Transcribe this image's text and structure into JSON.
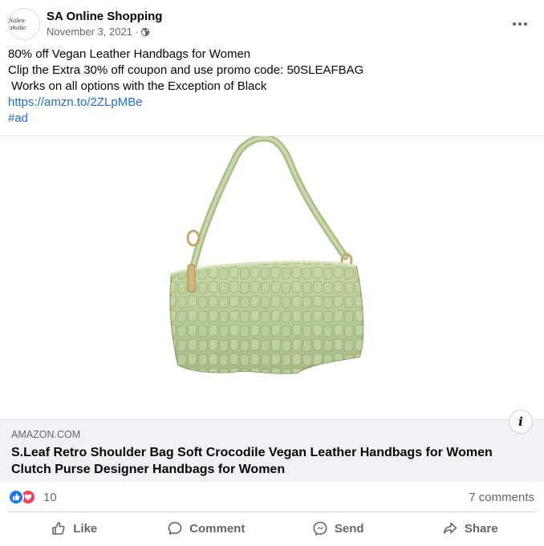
{
  "post": {
    "page_name": "SA Online Shopping",
    "avatar_text": "Sales-aholic",
    "date": "November 3, 2021",
    "separator": "·",
    "privacy_icon": "globe-icon",
    "more_icon": "more-options-icon",
    "text_lines": [
      "80% off Vegan Leather Handbags for Women",
      "Clip the Extra 30% off coupon and use promo code: 50SLEAFBAG",
      " Works on all options with the Exception of Black"
    ],
    "link_text": "https://amzn.to/2ZLpMBe",
    "hashtag": "#ad",
    "link_color": "#216fdb"
  },
  "image": {
    "subject": "green crocodile vegan leather shoulder bag",
    "bag_color": "#b9cc98"
  },
  "link_preview": {
    "domain": "AMAZON.COM",
    "title": "S.Leaf Retro Shoulder Bag Soft Crocodile Vegan Leather Handbags for Women Clutch Purse Designer Handbags for Women",
    "info_label": "i"
  },
  "engagement": {
    "reaction_count": "10",
    "comments": "7 comments",
    "reactions": [
      "like",
      "love"
    ]
  },
  "actions": {
    "like": "Like",
    "comment": "Comment",
    "send": "Send",
    "share": "Share"
  },
  "colors": {
    "accent": "#1877f2",
    "love": "#f33e58",
    "secondary_text": "#65676b",
    "preview_bg": "#f0f2f5"
  }
}
